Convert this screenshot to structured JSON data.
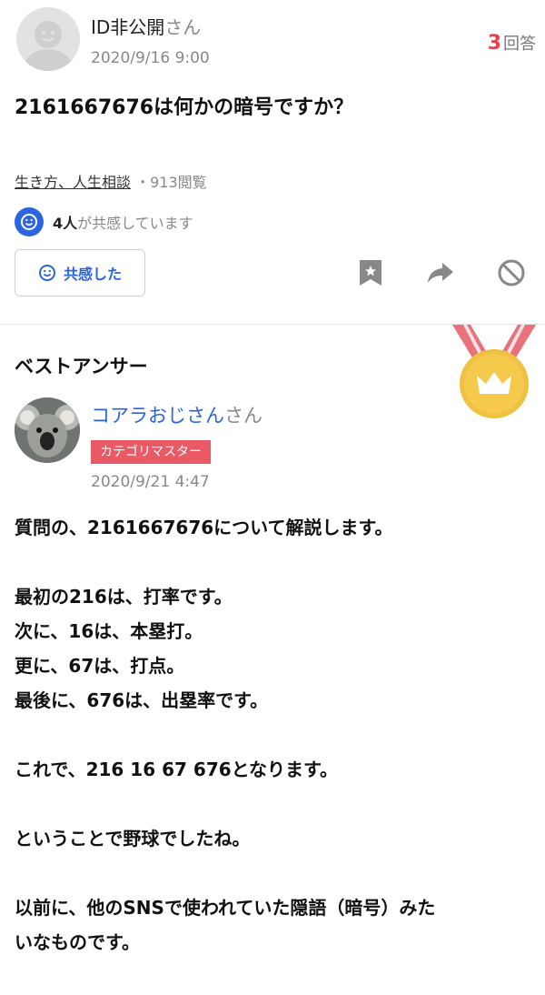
{
  "question": {
    "user_name": "ID非公開",
    "user_suffix": "さん",
    "date": "2020/9/16 9:00",
    "answer_count": "3",
    "answer_label": "回答",
    "text": "2161667676は何かの暗号ですか？",
    "category": "生き方、人生相談",
    "views": "・913閲覧",
    "empathy_count": "4人",
    "empathy_text": "が共感しています",
    "empathy_button": "共感した",
    "icons": [
      "bookmark-icon",
      "share-icon",
      "block-icon"
    ]
  },
  "answer": {
    "title": "ベストアンサー",
    "user_name": "コアラおじさん",
    "user_suffix": "さん",
    "badge": "カテゴリマスター",
    "date": "2020/9/21 4:47",
    "lines": [
      "質問の、2161667676について解説します。",
      "",
      "最初の216は、打率です。",
      "次に、16は、本塁打。",
      "更に、67は、打点。",
      "最後に、676は、出塁率です。",
      "",
      "これで、216 16 67 676となります。",
      "",
      "ということで野球でしたね。",
      "",
      "以前に、他のSNSで使われていた隠語（暗号）みた",
      "いなものです。"
    ]
  },
  "colors": {
    "accent_blue": "#2b64e0",
    "answer_count_red": "#e8434a",
    "badge_red": "#e95a64",
    "medal_gold": "#f0c040"
  }
}
